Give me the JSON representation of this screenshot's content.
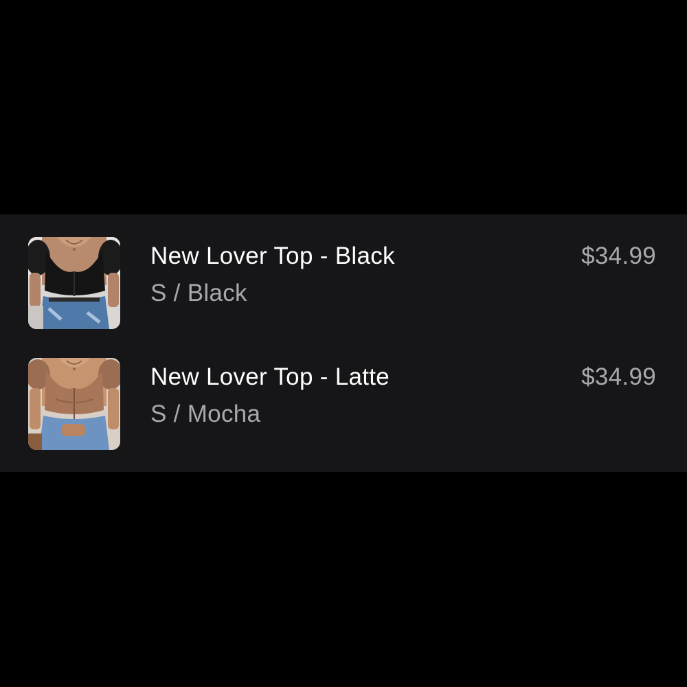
{
  "order_summary": {
    "items": [
      {
        "title": "New Lover Top - Black",
        "variant": "S / Black",
        "price": "$34.99",
        "thumbnail": "product-photo-black-top"
      },
      {
        "title": "New Lover Top - Latte",
        "variant": "S / Mocha",
        "price": "$34.99",
        "thumbnail": "product-photo-latte-top"
      }
    ]
  },
  "colors": {
    "page_background": "#000000",
    "panel_background": "#161618",
    "title_text": "#ffffff",
    "secondary_text": "#a9a9ad"
  }
}
